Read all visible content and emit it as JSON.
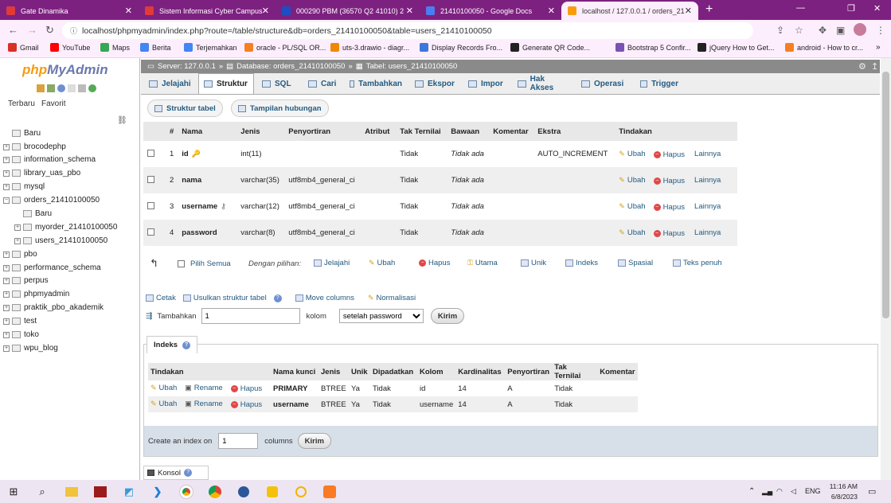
{
  "browser": {
    "tabs": [
      {
        "title": "Gate Dinamika",
        "fav_color": "#e03a3a"
      },
      {
        "title": "Sistem Informasi Cyber Campus",
        "fav_color": "#e03a3a"
      },
      {
        "title": "000290 PBM (36570 Q2 41010) 2",
        "fav_color": "#1d4fc4"
      },
      {
        "title": "21410100050 - Google Docs",
        "fav_color": "#4a7ef0"
      },
      {
        "title": "localhost / 127.0.0.1 / orders_21",
        "fav_color": "#f89c0e"
      }
    ],
    "url": "localhost/phpmyadmin/index.php?route=/table/structure&db=orders_21410100050&table=users_21410100050",
    "bookmarks": [
      {
        "label": "Gmail",
        "color": "#d93025"
      },
      {
        "label": "YouTube",
        "color": "#ff0000"
      },
      {
        "label": "Maps",
        "color": "#34a853"
      },
      {
        "label": "Berita",
        "color": "#4285f4"
      },
      {
        "label": "Terjemahkan",
        "color": "#4285f4"
      },
      {
        "label": "oracle - PL/SQL OR...",
        "color": "#f48024"
      },
      {
        "label": "uts-3.drawio - diagr...",
        "color": "#f08705"
      },
      {
        "label": "Display Records Fro...",
        "color": "#3c78d8"
      },
      {
        "label": "Generate QR Code...",
        "color": "#222222"
      },
      {
        "label": "Bootstrap 5 Confir...",
        "color": "#7952b3"
      },
      {
        "label": "jQuery How to Get...",
        "color": "#222222"
      },
      {
        "label": "android - How to cr...",
        "color": "#f48024"
      }
    ]
  },
  "sidebar": {
    "logo_php": "php",
    "logo_myadmin": "MyAdmin",
    "tab_recent": "Terbaru",
    "tab_favorite": "Favorit",
    "tree": [
      {
        "label": "Baru",
        "depth": 0
      },
      {
        "label": "brocodephp",
        "depth": 0
      },
      {
        "label": "information_schema",
        "depth": 0
      },
      {
        "label": "library_uas_pbo",
        "depth": 0
      },
      {
        "label": "mysql",
        "depth": 0
      },
      {
        "label": "orders_21410100050",
        "depth": 0
      },
      {
        "label": "Baru",
        "depth": 1
      },
      {
        "label": "myorder_21410100050",
        "depth": 1
      },
      {
        "label": "users_21410100050",
        "depth": 1
      },
      {
        "label": "pbo",
        "depth": 0
      },
      {
        "label": "performance_schema",
        "depth": 0
      },
      {
        "label": "perpus",
        "depth": 0
      },
      {
        "label": "phpmyadmin",
        "depth": 0
      },
      {
        "label": "praktik_pbo_akademik",
        "depth": 0
      },
      {
        "label": "test",
        "depth": 0
      },
      {
        "label": "toko",
        "depth": 0
      },
      {
        "label": "wpu_blog",
        "depth": 0
      }
    ]
  },
  "breadcrumb": {
    "server": "Server: 127.0.0.1",
    "database": "Database: orders_21410100050",
    "table": "Tabel: users_21410100050"
  },
  "menu": [
    "Jelajahi",
    "Struktur",
    "SQL",
    "Cari",
    "Tambahkan",
    "Ekspor",
    "Impor",
    "Hak Akses",
    "Operasi",
    "Trigger"
  ],
  "subtabs": {
    "structure": "Struktur tabel",
    "relation": "Tampilan hubungan"
  },
  "structure": {
    "headers": [
      "#",
      "Nama",
      "Jenis",
      "Penyortiran",
      "Atribut",
      "Tak Ternilai",
      "Bawaan",
      "Komentar",
      "Ekstra",
      "Tindakan"
    ],
    "rows": [
      {
        "num": "1",
        "name": "id",
        "type": "int(11)",
        "collation": "",
        "null": "Tidak",
        "default": "Tidak ada",
        "extra": "AUTO_INCREMENT"
      },
      {
        "num": "2",
        "name": "nama",
        "type": "varchar(35)",
        "collation": "utf8mb4_general_ci",
        "null": "Tidak",
        "default": "Tidak ada",
        "extra": ""
      },
      {
        "num": "3",
        "name": "username",
        "type": "varchar(12)",
        "collation": "utf8mb4_general_ci",
        "null": "Tidak",
        "default": "Tidak ada",
        "extra": ""
      },
      {
        "num": "4",
        "name": "password",
        "type": "varchar(8)",
        "collation": "utf8mb4_general_ci",
        "null": "Tidak",
        "default": "Tidak ada",
        "extra": ""
      }
    ],
    "action_edit": "Ubah",
    "action_delete": "Hapus",
    "action_more": "Lainnya"
  },
  "bulk": {
    "check_all": "Pilih Semua",
    "with_selected": "Dengan pilihan:",
    "actions": [
      "Jelajahi",
      "Ubah",
      "Hapus",
      "Utama",
      "Unik",
      "Indeks",
      "Spasial",
      "Teks penuh"
    ]
  },
  "tools": {
    "print": "Cetak",
    "propose": "Usulkan struktur tabel",
    "move": "Move columns",
    "normalize": "Normalisasi"
  },
  "add_columns": {
    "label": "Tambahkan",
    "count": "1",
    "unit": "kolom",
    "position": "setelah password",
    "submit": "Kirim"
  },
  "indexes": {
    "title": "Indeks",
    "headers": [
      "Tindakan",
      "Nama kunci",
      "Jenis",
      "Unik",
      "Dipadatkan",
      "Kolom",
      "Kardinalitas",
      "Penyortiran",
      "Tak Ternilai",
      "Komentar"
    ],
    "rows": [
      {
        "key": "PRIMARY",
        "type": "BTREE",
        "unique": "Ya",
        "packed": "Tidak",
        "column": "id",
        "cardinality": "14",
        "collation": "A",
        "null": "Tidak"
      },
      {
        "key": "username",
        "type": "BTREE",
        "unique": "Ya",
        "packed": "Tidak",
        "column": "username",
        "cardinality": "14",
        "collation": "A",
        "null": "Tidak"
      }
    ],
    "edit": "Ubah",
    "rename": "Rename",
    "delete": "Hapus",
    "create_label": "Create an index on",
    "create_count": "1",
    "create_unit": "columns",
    "create_submit": "Kirim"
  },
  "console": "Konsol",
  "taskbar": {
    "time": "11:16 AM",
    "date": "6/8/2023",
    "lang": "ENG"
  }
}
